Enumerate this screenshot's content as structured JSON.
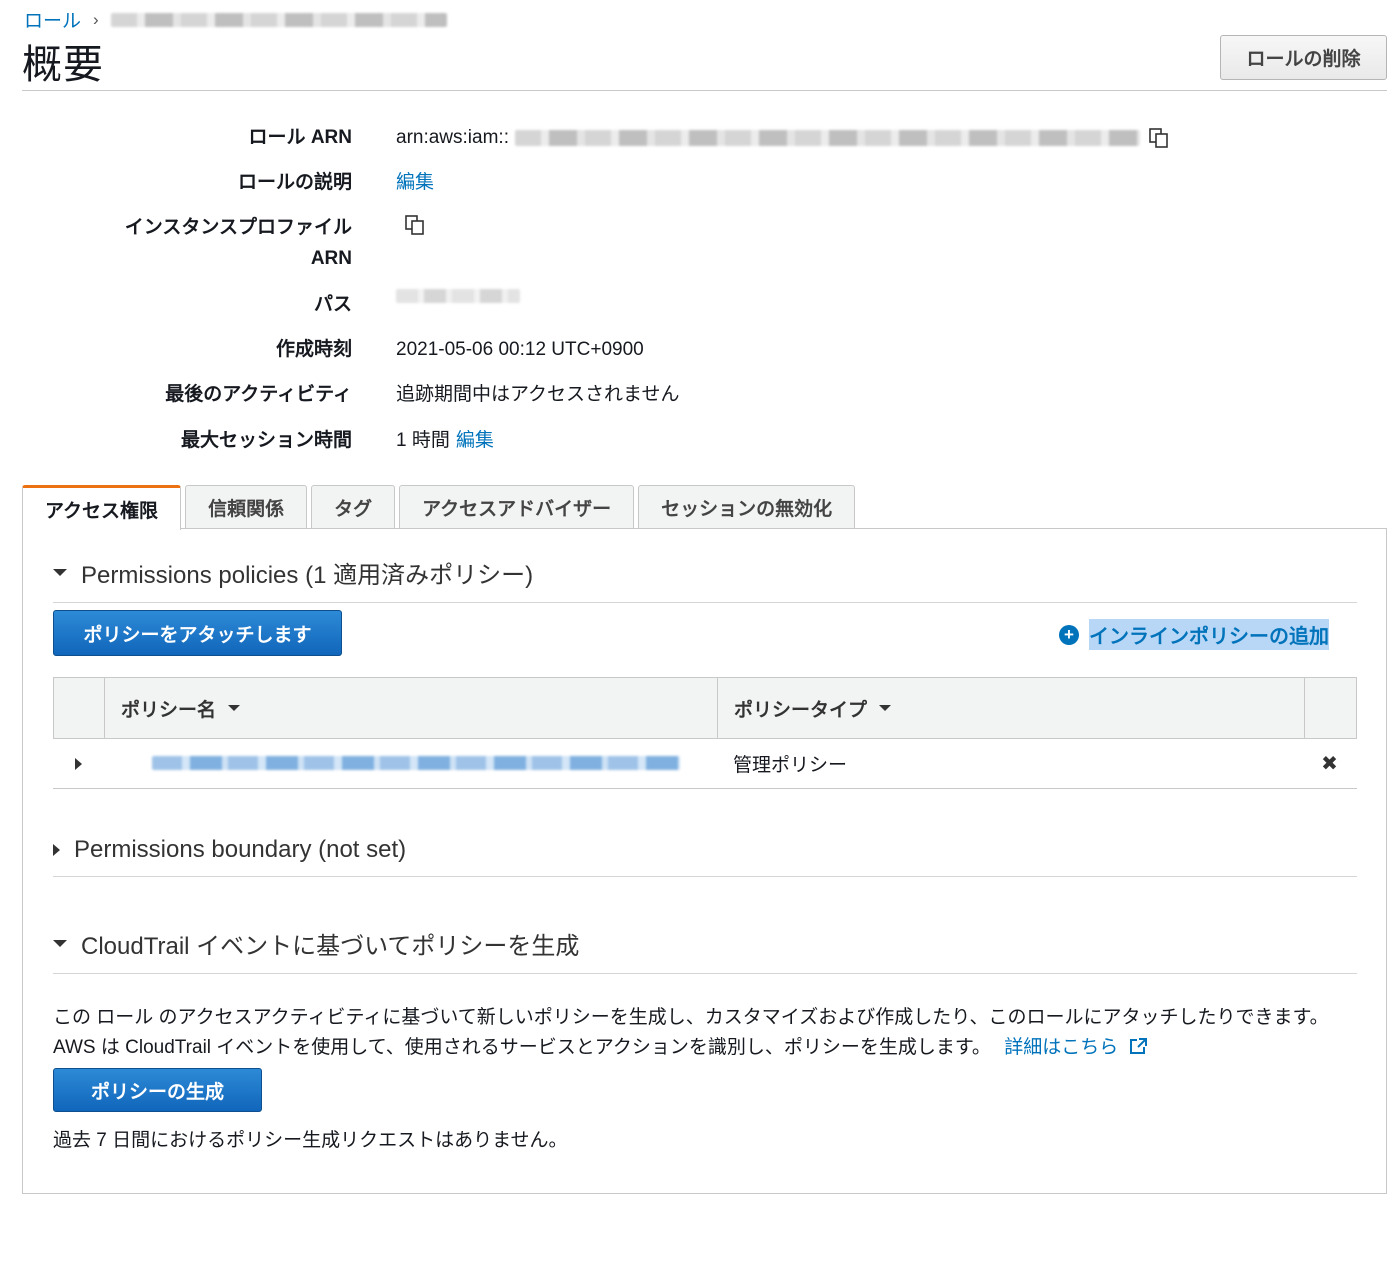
{
  "breadcrumb": {
    "roles_link": "ロール",
    "separator": "›"
  },
  "header": {
    "title": "概要",
    "delete_button": "ロールの削除"
  },
  "summary": {
    "role_arn_label": "ロール ARN",
    "role_arn_prefix": "arn:aws:iam::",
    "description_label": "ロールの説明",
    "description_edit": "編集",
    "instance_profile_label_line1": "インスタンスプロファイル",
    "instance_profile_label_line2": "ARN",
    "path_label": "パス",
    "created_label": "作成時刻",
    "created_value": "2021-05-06 00:12 UTC+0900",
    "last_activity_label": "最後のアクティビティ",
    "last_activity_value": "追跡期間中はアクセスされません",
    "max_session_label": "最大セッション時間",
    "max_session_value": "1 時間",
    "max_session_edit": "編集"
  },
  "tabs": [
    {
      "label": "アクセス権限",
      "active": true
    },
    {
      "label": "信頼関係",
      "active": false
    },
    {
      "label": "タグ",
      "active": false
    },
    {
      "label": "アクセスアドバイザー",
      "active": false
    },
    {
      "label": "セッションの無効化",
      "active": false
    }
  ],
  "permissions": {
    "section_title": "Permissions policies (1 適用済みポリシー)",
    "attach_button": "ポリシーをアタッチします",
    "add_inline_link": "インラインポリシーの追加",
    "columns": [
      "ポリシー名",
      "ポリシータイプ"
    ],
    "rows": [
      {
        "type": "管理ポリシー",
        "remove_icon": "✖"
      }
    ]
  },
  "boundary": {
    "section_title": "Permissions boundary (not set)"
  },
  "cloudtrail": {
    "section_title": "CloudTrail イベントに基づいてポリシーを生成",
    "description": "この ロール のアクセスアクティビティに基づいて新しいポリシーを生成し、カスタマイズおよび作成したり、このロールにアタッチしたりできます。AWS は CloudTrail イベントを使用して、使用されるサービスとアクションを識別し、ポリシーを生成します。",
    "learn_more": "詳細はこちら",
    "generate_button": "ポリシーの生成",
    "no_requests": "過去 7 日間におけるポリシー生成リクエストはありません。"
  },
  "colors": {
    "link": "#0073bb",
    "primary": "#1166bb",
    "active_tab": "#ec7211"
  }
}
